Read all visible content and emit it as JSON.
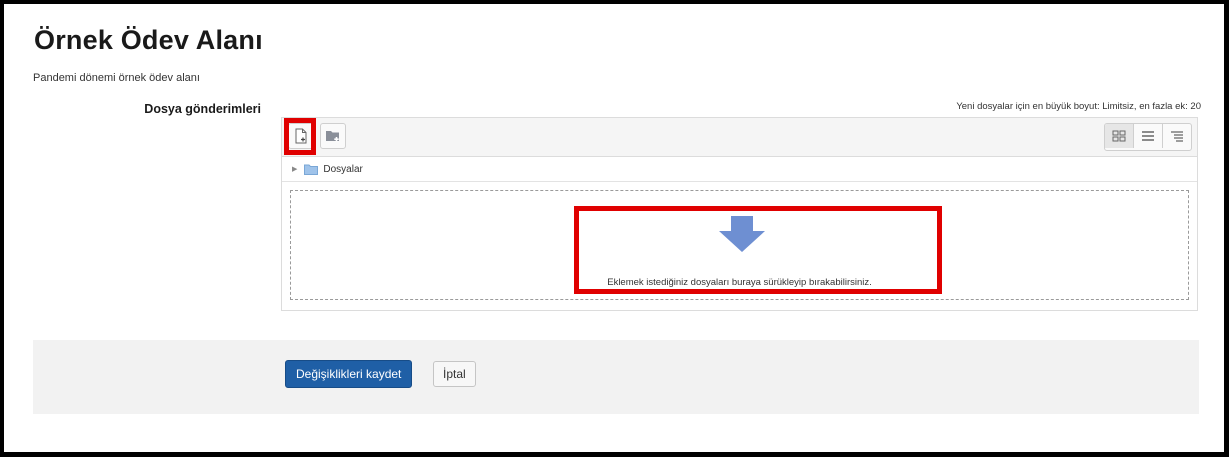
{
  "page": {
    "title": "Örnek Ödev Alanı",
    "intro": "Pandemi dönemi örnek ödev alanı"
  },
  "field": {
    "label": "Dosya gönderimleri",
    "limits": "Yeni dosyalar için en büyük boyut: Limitsiz, en fazla ek: 20"
  },
  "filepicker": {
    "toolbar": {
      "add_icon": "add-file-icon",
      "folder_icon": "create-folder-icon",
      "view_icons": [
        "view-icons-icon",
        "view-details-icon",
        "view-tree-icon"
      ]
    },
    "path": {
      "folder_label": "Dosyalar"
    },
    "dropzone": {
      "text": "Eklemek istediğiniz dosyaları buraya sürükleyip bırakabilirsiniz.",
      "arrow_color": "#6e8fd2"
    }
  },
  "actions": {
    "save_label": "Değişiklikleri kaydet",
    "cancel_label": "İptal"
  },
  "colors": {
    "primary_button": "#1f5fa6",
    "highlight": "#e00000"
  }
}
